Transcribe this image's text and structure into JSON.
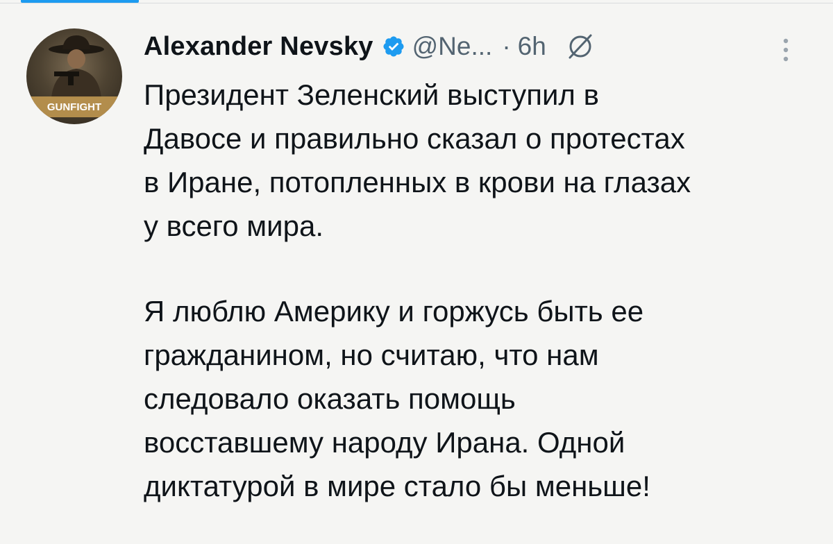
{
  "tweet": {
    "author": {
      "display_name": "Alexander Nevsky",
      "handle": "@Ne...",
      "verified": true,
      "avatar_text": "GUNFIGHT"
    },
    "separator": "·",
    "time": "6h",
    "icons": {
      "verified": "verified-badge-icon",
      "grok": "grok-icon",
      "more": "more-vertical-icon"
    },
    "paragraphs": [
      {
        "lines": [
          "Президент Зеленский выступил в",
          "Давосе и правильно сказал о протестах",
          "в Иране, потопленных в крови на глазах",
          "у всего мира."
        ]
      },
      {
        "lines": [
          "Я люблю Америку и горжусь быть ее",
          "гражданином, но считаю, что нам",
          "следовало оказать помощь",
          "восставшему народу Ирана. Одной",
          "диктатурой в мире стало бы меньше!"
        ]
      }
    ],
    "colors": {
      "accent": "#1d9bf0",
      "text": "#0f1419",
      "secondary": "#536471",
      "background": "#f5f5f3"
    }
  }
}
